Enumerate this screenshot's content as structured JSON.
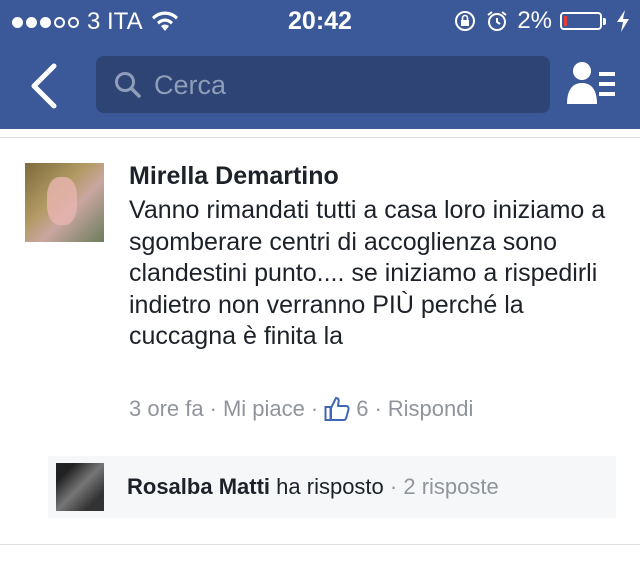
{
  "status_bar": {
    "carrier": "3 ITA",
    "time": "20:42",
    "battery": "2%"
  },
  "nav": {
    "search_placeholder": "Cerca",
    "icons": [
      "back-chevron-icon",
      "search-icon",
      "friends-icon"
    ]
  },
  "comment": {
    "author": "Mirella Demartino",
    "text": "Vanno rimandati tutti a casa loro iniziamo a sgomberare centri di accoglienza sono clandestini punto.... se iniziamo a rispedirli indietro non verranno PIÙ perché la cuccagna è finita la",
    "time": "3 ore fa",
    "like_label": "Mi piace",
    "like_count": "6",
    "reply_label": "Rispondi",
    "separator": "·"
  },
  "reply_summary": {
    "author": "Rosalba Matti",
    "action": "ha risposto",
    "separator": "·",
    "count": "2 risposte"
  },
  "colors": {
    "brand": "#3b5998",
    "search_bg": "#2d4475",
    "muted_text": "#90949c",
    "like_blue": "#4267b2"
  }
}
